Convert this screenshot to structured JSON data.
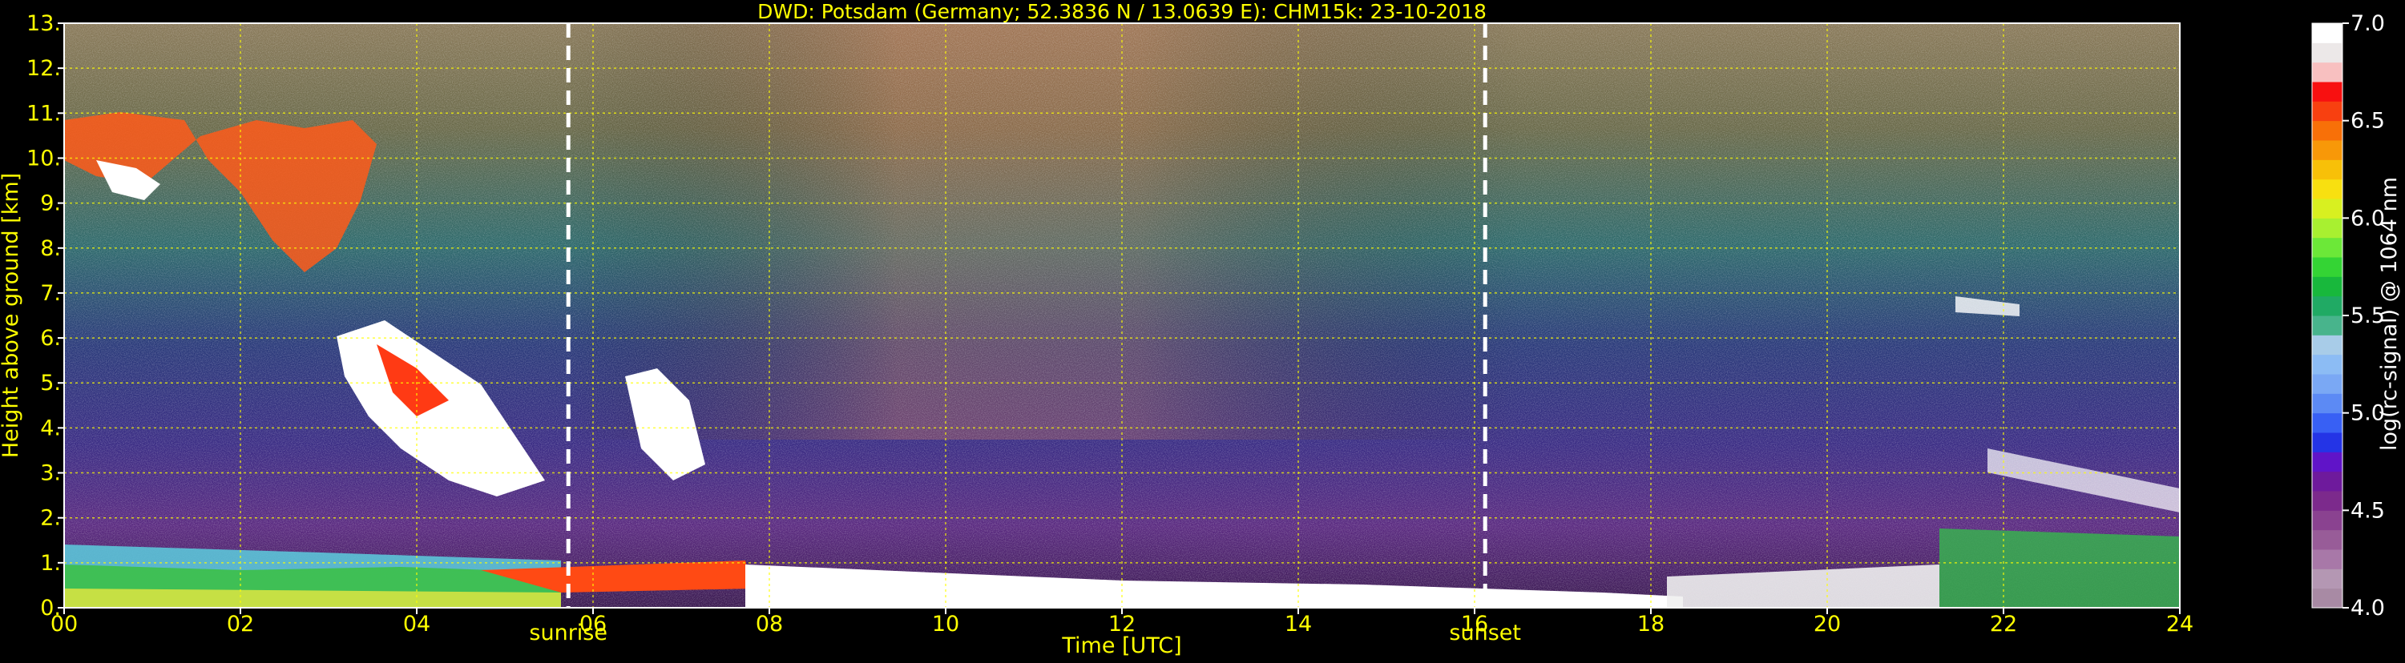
{
  "chart_data": {
    "type": "heatmap",
    "title": "DWD: Potsdam (Germany; 52.3836 N / 13.0639 E):    CHM15k: 23-10-2018",
    "xlabel": "Time [UTC]",
    "ylabel": "Height above ground [km]",
    "xlim": [
      0,
      24
    ],
    "ylim": [
      0,
      13
    ],
    "x_ticks": [
      "00",
      "02",
      "04",
      "06",
      "08",
      "10",
      "12",
      "14",
      "16",
      "18",
      "20",
      "22",
      "24"
    ],
    "y_ticks": [
      "0.",
      "1.",
      "2.",
      "3.",
      "4.",
      "5.",
      "6.",
      "7.",
      "8.",
      "9.",
      "10.",
      "11.",
      "12.",
      "13."
    ],
    "grid": true,
    "annotations": [
      {
        "label": "sunrise",
        "x": 5.72
      },
      {
        "label": "sunset",
        "x": 16.12
      }
    ],
    "colorbar": {
      "label": "log(rc-signal) @ 1064 nm",
      "range": [
        4.0,
        7.0
      ],
      "ticks": [
        "4.0",
        "4.5",
        "5.0",
        "5.5",
        "6.0",
        "6.5",
        "7.0"
      ],
      "colors": [
        "#a88aa4",
        "#b497b3",
        "#a878a8",
        "#985c98",
        "#8a4290",
        "#7c2a8c",
        "#6e1a9c",
        "#6014c8",
        "#2434e6",
        "#3860f4",
        "#5c8af4",
        "#7aa8f4",
        "#8cbcf4",
        "#a8cce8",
        "#48b48c",
        "#20aa64",
        "#18b83c",
        "#34d434",
        "#6ce838",
        "#a8f030",
        "#d8f020",
        "#f8e010",
        "#f8c008",
        "#f89808",
        "#f87008",
        "#f84010",
        "#f81010",
        "#f8c0c0",
        "#ece8e8",
        "#ffffff"
      ]
    }
  }
}
